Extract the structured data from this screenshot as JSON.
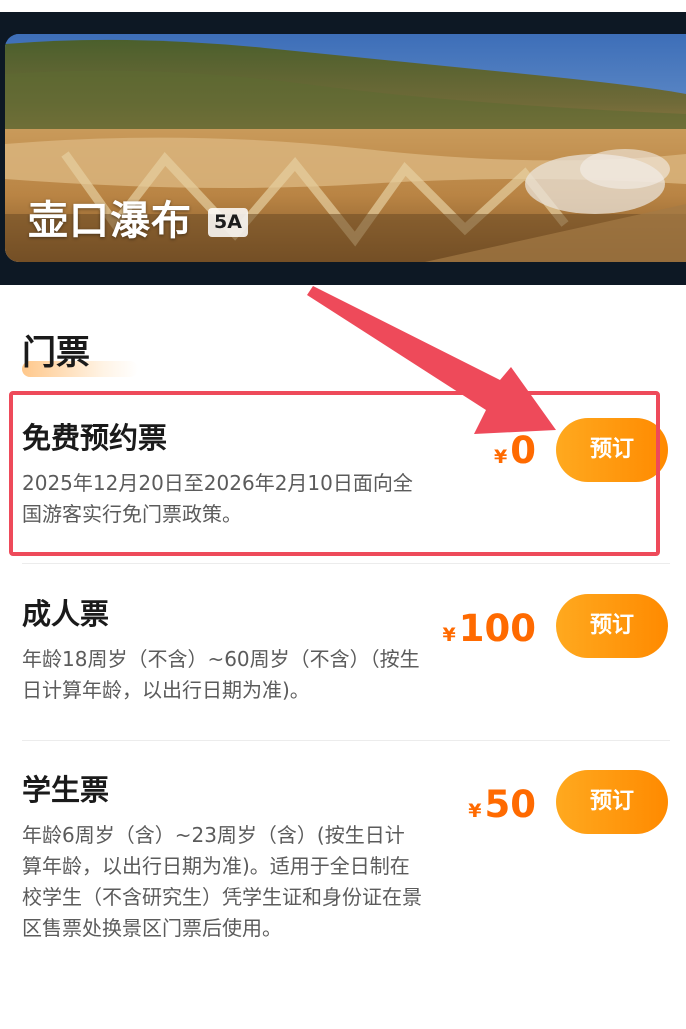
{
  "hero": {
    "title": "壶口瀑布",
    "badge": "5A"
  },
  "section": {
    "title": "门票"
  },
  "tickets": [
    {
      "name": "免费预约票",
      "description": "2025年12月20日至2026年2月10日面向全国游客实行免门票政策。",
      "currency": "¥",
      "price": "0",
      "button_label": "预订"
    },
    {
      "name": "成人票",
      "description": "年龄18周岁（不含）~60周岁（不含）（按生日计算年龄，以出行日期为准)。",
      "currency": "¥",
      "price": "100",
      "button_label": "预订"
    },
    {
      "name": "学生票",
      "description": "年龄6周岁（含）~23周岁（含）(按生日计算年龄，以出行日期为准)。适用于全日制在校学生（不含研究生）凭学生证和身份证在景区售票处换景区门票后使用。",
      "currency": "¥",
      "price": "50",
      "button_label": "预订"
    }
  ],
  "colors": {
    "accent": "#ff8a00",
    "price": "#ff6a00",
    "annotation": "#ee4a5a"
  }
}
